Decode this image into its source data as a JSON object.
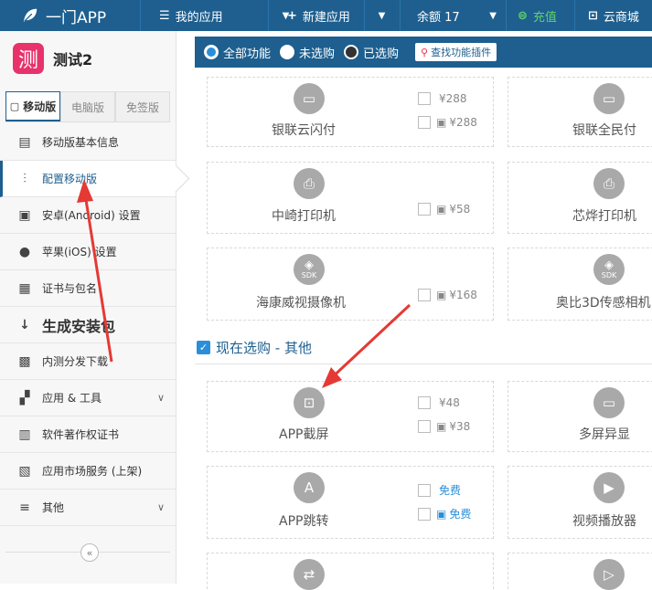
{
  "topbar": {
    "brand": "一门APP",
    "my_apps": "我的应用",
    "new_app": "新建应用",
    "balance": "余额 17",
    "recharge": "充值",
    "store": "云商城"
  },
  "app": {
    "icon_char": "测",
    "name": "测试2"
  },
  "tabs": [
    "移动版",
    "电脑版",
    "免签版"
  ],
  "menu": [
    {
      "label": "移动版基本信息"
    },
    {
      "label": "配置移动版"
    },
    {
      "label": "安卓(Android) 设置"
    },
    {
      "label": "苹果(iOS) 设置"
    },
    {
      "label": "证书与包名"
    },
    {
      "label": "生成安装包"
    },
    {
      "label": "内测分发下载"
    },
    {
      "label": "应用 & 工具"
    },
    {
      "label": "软件著作权证书"
    },
    {
      "label": "应用市场服务 (上架)"
    },
    {
      "label": "其他"
    }
  ],
  "filter": {
    "all": "全部功能",
    "unselected": "未选购",
    "selected": "已选购",
    "search": "查找功能插件"
  },
  "cards": {
    "c1": {
      "title": "银联云闪付",
      "ios_price": "¥288",
      "android_price": "¥288"
    },
    "c2": {
      "title": "银联全民付"
    },
    "c3": {
      "title": "中崎打印机",
      "android_price": "¥58"
    },
    "c4": {
      "title": "芯烨打印机"
    },
    "c5": {
      "title": "海康威视摄像机",
      "android_price": "¥168",
      "badge": "SDK"
    },
    "c6": {
      "title": "奥比3D传感相机",
      "badge": "SDK"
    },
    "c7": {
      "title": "APP截屏",
      "ios_price": "¥48",
      "android_price": "¥38"
    },
    "c8": {
      "title": "多屏异显"
    },
    "c9": {
      "title": "APP跳转",
      "ios_price": "免费",
      "android_price": "免费"
    },
    "c10": {
      "title": "视频播放器"
    }
  },
  "section": {
    "title": "现在选购 - 其他"
  },
  "colors": {
    "primary": "#1e5f8f",
    "accent": "#2a8fd8",
    "arrow": "#e53935",
    "app_icon": "#e8326c"
  }
}
